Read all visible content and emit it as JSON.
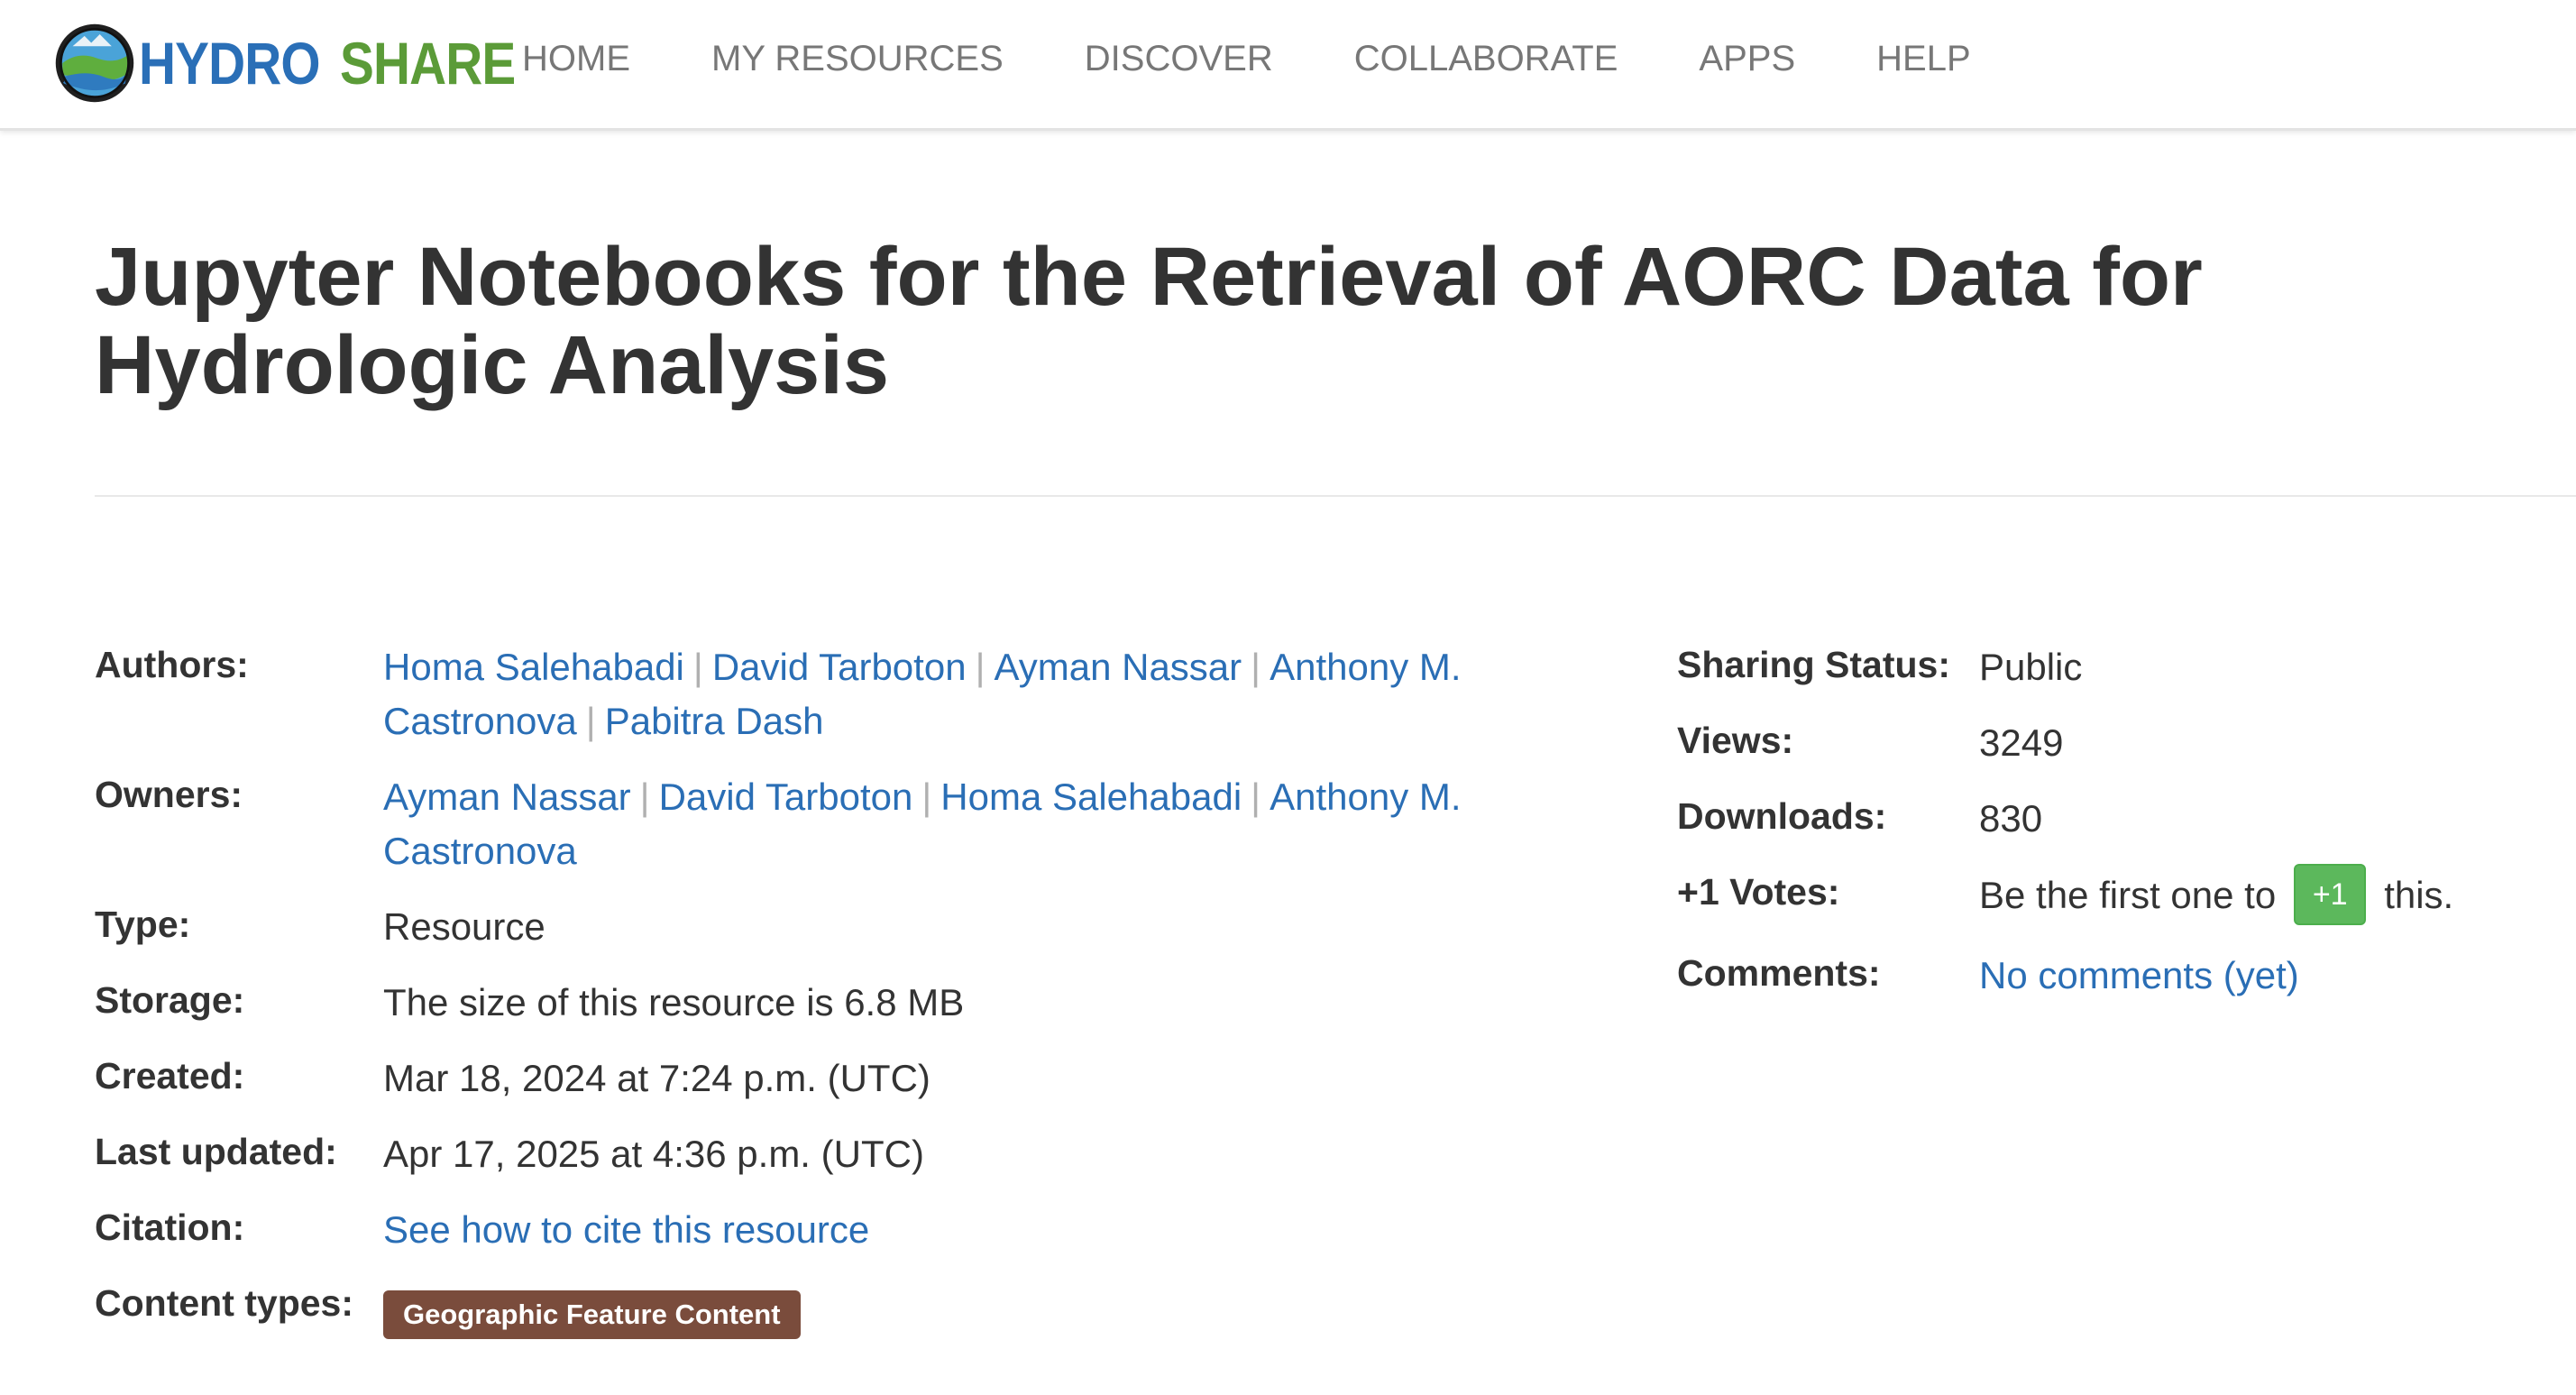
{
  "header": {
    "logo_word_1": "HYDRO",
    "logo_word_2": "SHARE",
    "nav": [
      "HOME",
      "MY RESOURCES",
      "DISCOVER",
      "COLLABORATE",
      "APPS",
      "HELP"
    ]
  },
  "resource": {
    "title": "Jupyter Notebooks for the Retrieval of AORC Data for Hydrologic Analysis"
  },
  "labels": {
    "authors": "Authors:",
    "owners": "Owners:",
    "type": "Type:",
    "storage": "Storage:",
    "created": "Created:",
    "last_updated": "Last updated:",
    "citation": "Citation:",
    "content_types": "Content types:",
    "sharing_status": "Sharing Status:",
    "views": "Views:",
    "downloads": "Downloads:",
    "votes": "+1 Votes:",
    "comments": "Comments:"
  },
  "authors": [
    "Homa Salehabadi",
    "David Tarboton",
    "Ayman Nassar",
    "Anthony M. Castronova",
    "Pabitra Dash"
  ],
  "owners": [
    "Ayman Nassar",
    "David Tarboton",
    "Homa Salehabadi",
    "Anthony M. Castronova"
  ],
  "type_value": "Resource",
  "storage_value": "The size of this resource is 6.8 MB",
  "created_value": "Mar 18, 2024 at 7:24 p.m. (UTC)",
  "last_updated_value": "Apr 17, 2025 at 4:36 p.m. (UTC)",
  "citation_link": "See how to cite this resource",
  "content_type_badge": "Geographic Feature Content",
  "sharing_status_value": "Public",
  "views_value": "3249",
  "downloads_value": "830",
  "votes": {
    "prefix": "Be the first one to",
    "button": "+1",
    "suffix": "this."
  },
  "comments_link": "No comments (yet)",
  "colors": {
    "link": "#2a6eb5",
    "badge": "#7a4c3c",
    "plusone": "#5cb85c",
    "logo_blue": "#2a6fb7",
    "logo_green": "#5b9b38"
  },
  "icons": {
    "logo": "globe-logo-icon"
  }
}
